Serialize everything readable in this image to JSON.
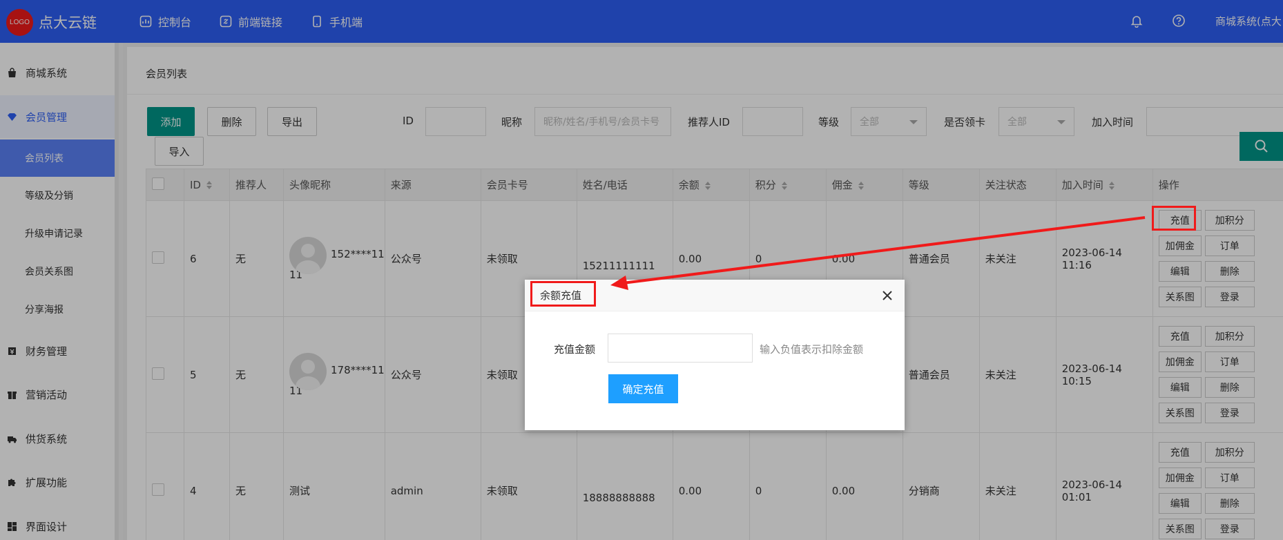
{
  "header": {
    "logo_text": "LOGO",
    "brand": "点大云链",
    "nav": [
      {
        "label": "控制台",
        "icon": "dashboard-icon"
      },
      {
        "label": "前端链接",
        "icon": "link-icon"
      },
      {
        "label": "手机端",
        "icon": "mobile-icon"
      }
    ],
    "user": "商城系统(点大"
  },
  "sidebar": {
    "items": [
      {
        "label": "商城系统",
        "icon": "shop-bag-icon"
      },
      {
        "label": "会员管理",
        "icon": "diamond-icon"
      },
      {
        "label": "会员列表"
      },
      {
        "label": "等级及分销"
      },
      {
        "label": "升级申请记录"
      },
      {
        "label": "会员关系图"
      },
      {
        "label": "分享海报"
      },
      {
        "label": "财务管理",
        "icon": "finance-icon"
      },
      {
        "label": "营销活动",
        "icon": "gift-icon"
      },
      {
        "label": "供货系统",
        "icon": "truck-icon"
      },
      {
        "label": "扩展功能",
        "icon": "puzzle-icon"
      },
      {
        "label": "界面设计",
        "icon": "layout-icon"
      }
    ]
  },
  "page": {
    "title": "会员列表",
    "buttons": {
      "add": "添加",
      "delete": "删除",
      "export": "导出",
      "import": "导入"
    },
    "filters": {
      "id_label": "ID",
      "nickname_label": "昵称",
      "nickname_placeholder": "昵称/姓名/手机号/会员卡号",
      "referrer_label": "推荐人ID",
      "level_label": "等级",
      "level_value": "全部",
      "card_label": "是否领卡",
      "card_value": "全部",
      "join_label": "加入时间"
    }
  },
  "table": {
    "headers": [
      "ID",
      "推荐人",
      "头像昵称",
      "来源",
      "会员卡号",
      "姓名/电话",
      "余额",
      "积分",
      "佣金",
      "等级",
      "关注状态",
      "加入时间",
      "操作"
    ],
    "rows": [
      {
        "id": "6",
        "referrer": "无",
        "nick": "152****11",
        "nick2": "11",
        "source": "公众号",
        "card": "未领取",
        "phone": "15211111111",
        "balance": "0.00",
        "points": "0",
        "commission": "0.00",
        "level": "普通会员",
        "follow": "未关注",
        "joined": "2023-06-14 11:16"
      },
      {
        "id": "5",
        "referrer": "无",
        "nick": "178****11",
        "nick2": "11",
        "source": "公众号",
        "card": "未领取",
        "phone": "",
        "balance": "",
        "points": "",
        "commission": "",
        "level": "普通会员",
        "follow": "未关注",
        "joined": "2023-06-14 10:15"
      },
      {
        "id": "4",
        "referrer": "无",
        "nick": "测试",
        "nick2": "",
        "source": "admin",
        "card": "未领取",
        "phone": "18888888888",
        "balance": "0.00",
        "points": "0",
        "commission": "0.00",
        "level": "分销商",
        "follow": "未关注",
        "joined": "2023-06-14 01:01"
      }
    ],
    "ops": [
      "充值",
      "加积分",
      "加佣金",
      "订单",
      "编辑",
      "删除",
      "关系图",
      "登录"
    ]
  },
  "modal": {
    "title": "余额充值",
    "amount_label": "充值金额",
    "hint": "输入负值表示扣除金额",
    "confirm": "确定充值"
  },
  "colors": {
    "primary": "#2d5ff5",
    "green": "#009688",
    "confirm": "#1e9fff",
    "highlight": "#f01a1a"
  }
}
